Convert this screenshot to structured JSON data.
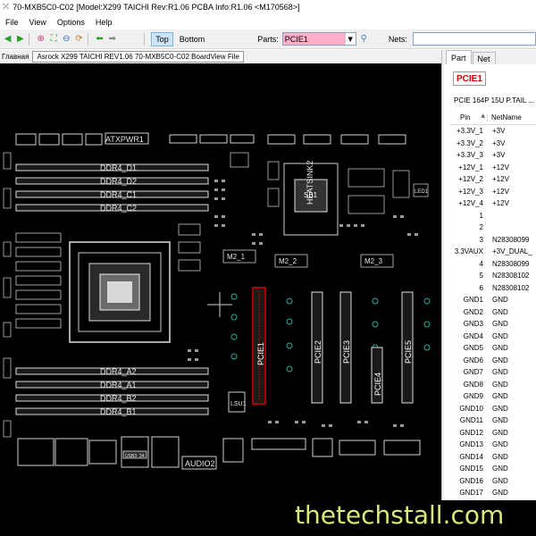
{
  "window": {
    "title": "70-MXB5C0-C02 [Model:X299 TAICHI Rev:R1.06 PCBA Info:R1.06     <M170568>]"
  },
  "menu": [
    "File",
    "View",
    "Options",
    "Help"
  ],
  "toolbar": {
    "side_top": "Top",
    "side_bottom": "Bottom",
    "parts_label": "Parts:",
    "parts_value": "PCIE1",
    "nets_label": "Nets:"
  },
  "docbar": {
    "label": "Главная",
    "tab": "Asrock X299 TAICHI REV1.06 70-MXB5C0-C02 BoardView File"
  },
  "board": {
    "atx_label": "ATXPWR1",
    "ddr_top": [
      "DDR4_D1",
      "DDR4_D2",
      "DDR4_C1",
      "DDR4_C2"
    ],
    "ddr_bottom": [
      "DDR4_A2",
      "DDR4_A1",
      "DDR4_B2",
      "DDR4_B1"
    ],
    "m2": [
      "M2_1",
      "M2_2",
      "M2_3"
    ],
    "slots": [
      "PCIE1",
      "PCIE2",
      "PCIE3",
      "PCIE4",
      "PCIE5"
    ],
    "chip_label": "SB1",
    "heatsink_label": "HEATSINK2",
    "lsu": "LSU1",
    "usb": "USB3_34",
    "audio": "AUDIO2",
    "led": "LED1",
    "highlight_color": "#d00000"
  },
  "panel": {
    "tab_part": "Part",
    "tab_net": "Net",
    "part_name": "PCIE1",
    "part_desc": "PCIE 164P 15U P.TAIL ...",
    "col_pin": "Pin",
    "col_netname": "NetName",
    "pins": [
      {
        "pin": "+3.3V_1",
        "net": "+3V"
      },
      {
        "pin": "+3.3V_2",
        "net": "+3V"
      },
      {
        "pin": "+3.3V_3",
        "net": "+3V"
      },
      {
        "pin": "+12V_1",
        "net": "+12V"
      },
      {
        "pin": "+12V_2",
        "net": "+12V"
      },
      {
        "pin": "+12V_3",
        "net": "+12V"
      },
      {
        "pin": "+12V_4",
        "net": "+12V"
      },
      {
        "pin": "1",
        "net": ""
      },
      {
        "pin": "2",
        "net": ""
      },
      {
        "pin": "3",
        "net": "N28308099"
      },
      {
        "pin": "3.3VAUX",
        "net": "+3V_DUAL_"
      },
      {
        "pin": "4",
        "net": "N28308099"
      },
      {
        "pin": "5",
        "net": "N28308102"
      },
      {
        "pin": "6",
        "net": "N28308102"
      },
      {
        "pin": "GND1",
        "net": "GND"
      },
      {
        "pin": "GND2",
        "net": "GND"
      },
      {
        "pin": "GND3",
        "net": "GND"
      },
      {
        "pin": "GND4",
        "net": "GND"
      },
      {
        "pin": "GND5",
        "net": "GND"
      },
      {
        "pin": "GND6",
        "net": "GND"
      },
      {
        "pin": "GND7",
        "net": "GND"
      },
      {
        "pin": "GND8",
        "net": "GND"
      },
      {
        "pin": "GND9",
        "net": "GND"
      },
      {
        "pin": "GND10",
        "net": "GND"
      },
      {
        "pin": "GND11",
        "net": "GND"
      },
      {
        "pin": "GND12",
        "net": "GND"
      },
      {
        "pin": "GND13",
        "net": "GND"
      },
      {
        "pin": "GND14",
        "net": "GND"
      },
      {
        "pin": "GND15",
        "net": "GND"
      },
      {
        "pin": "GND16",
        "net": "GND"
      },
      {
        "pin": "GND17",
        "net": "GND"
      }
    ]
  },
  "watermark": "thetechstall.com"
}
